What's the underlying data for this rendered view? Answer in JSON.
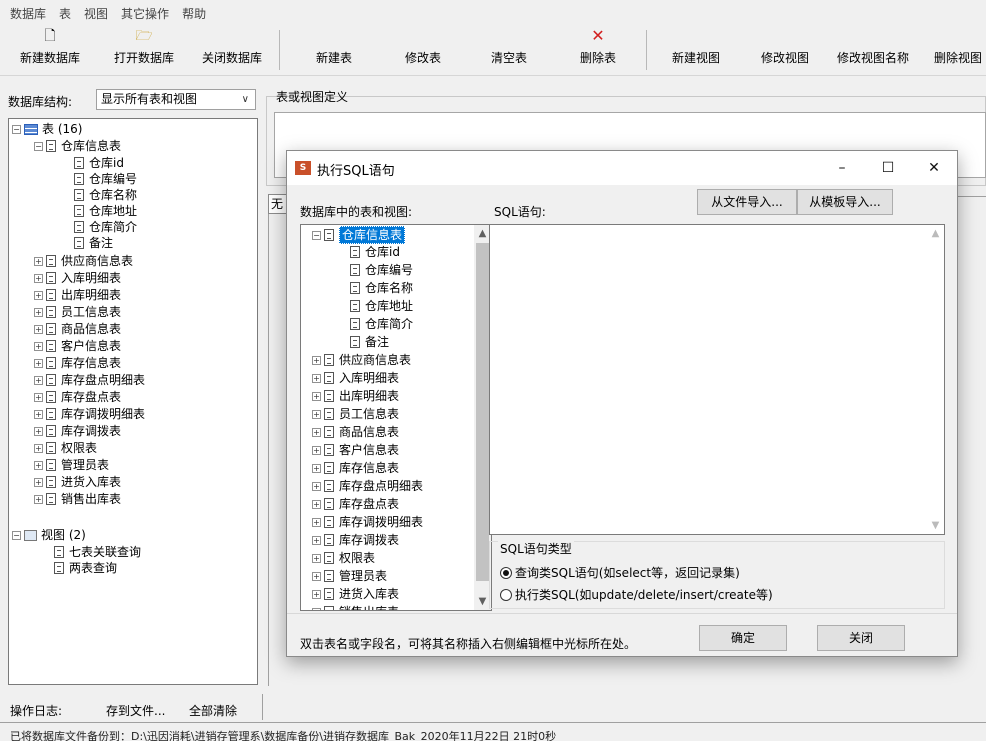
{
  "menu": [
    "数据库",
    "表",
    "视图",
    "其它操作",
    "帮助"
  ],
  "toolbar": {
    "buttons": [
      "新建数据库",
      "打开数据库",
      "关闭数据库",
      "新建表",
      "修改表",
      "清空表",
      "删除表",
      "新建视图",
      "修改视图",
      "修改视图名称",
      "删除视图"
    ]
  },
  "left": {
    "structure_label": "数据库结构:",
    "structure_select": "显示所有表和视图",
    "tree": {
      "tables_node": "表 (16)",
      "expanded_table": "仓库信息表",
      "fields": [
        "仓库id",
        "仓库编号",
        "仓库名称",
        "仓库地址",
        "仓库简介",
        "备注"
      ],
      "tables": [
        "供应商信息表",
        "入库明细表",
        "出库明细表",
        "员工信息表",
        "商品信息表",
        "客户信息表",
        "库存信息表",
        "库存盘点明细表",
        "库存盘点表",
        "库存调拨明细表",
        "库存调拨表",
        "权限表",
        "管理员表",
        "进货入库表",
        "销售出库表"
      ],
      "views_node": "视图 (2)",
      "views": [
        "七表关联查询",
        "两表查询"
      ]
    }
  },
  "definition": {
    "label": "表或视图定义",
    "tab_fragment": "无"
  },
  "log": {
    "label": "操作日志:",
    "save": "存到文件...",
    "clear": "全部清除",
    "text": "已将数据库文件备份到：D:\\迅因消耗\\进销存管理系\\数据库备份\\进销存数据库_Bak_2020年11月22日 21时0秒"
  },
  "dialog": {
    "title": "执行SQL语句",
    "app_icon": "S",
    "controls": {
      "minimize": "–",
      "maximize": "☐",
      "close": "✕"
    },
    "tables_label": "数据库中的表和视图:",
    "sql_label": "SQL语句:",
    "import_file": "从文件导入...",
    "import_template": "从模板导入...",
    "sql_text": "",
    "type_group": "SQL语句类型",
    "radio_query": "查询类SQL语句(如select等，返回记录集)",
    "radio_exec": "执行类SQL(如update/delete/insert/create等)",
    "radio_selected": "query",
    "hint": "双击表名或字段名，可将其名称插入右侧编辑框中光标所在处。",
    "ok": "确定",
    "close": "关闭"
  }
}
